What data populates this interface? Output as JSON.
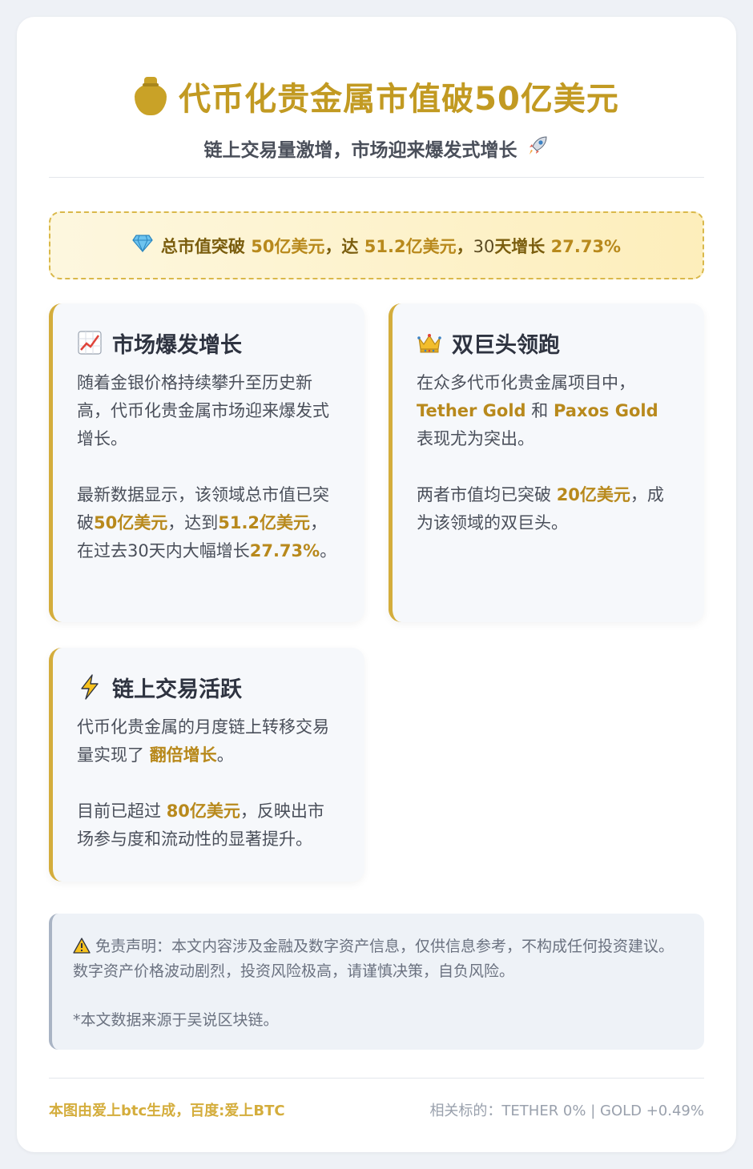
{
  "header": {
    "icon": "money-bag-icon",
    "title": "代币化贵金属市值破50亿美元",
    "subtitle": "链上交易量激增，市场迎来爆发式增长",
    "subtitle_icon": "rocket-icon"
  },
  "highlight": {
    "icon": "gem-icon",
    "p1": "总市值突破",
    "v1": "50亿美元",
    "p2": "，达",
    "v2": "51.2亿美元",
    "p3": "，",
    "p4": "30",
    "p5": "天增长",
    "v3": "27.73%"
  },
  "sections": [
    {
      "icon": "chart-increasing-icon",
      "title": "市场爆发增长",
      "para1": "随着金银价格持续攀升至历史新高，代币化贵金属市场迎来爆发式增长。",
      "para2_a": "最新数据显示，该领域总市值已突破",
      "para2_b": "50亿美元",
      "para2_c": "，达到",
      "para2_d": "51.2亿美元",
      "para2_e": "，在过去30天内大幅增长",
      "para2_f": "27.73%",
      "para2_g": "。"
    },
    {
      "icon": "crown-icon",
      "title": "双巨头领跑",
      "para1_a": "在众多代币化贵金属项目中，",
      "para1_b": "Tether Gold",
      "para1_c": "和",
      "para1_d": "Paxos Gold",
      "para1_e": "表现尤为突出。",
      "para2_a": "两者市值均已突破",
      "para2_b": "20亿美元",
      "para2_c": "，成为该领域的双巨头。"
    },
    {
      "icon": "lightning-icon",
      "title": "链上交易活跃",
      "para1_a": "代币化贵金属的月度链上转移交易量实现了",
      "para1_b": "翻倍增长",
      "para1_c": "。",
      "para2_a": "目前已超过",
      "para2_b": "80亿美元",
      "para2_c": "，反映出市场参与度和流动性的显著提升。"
    }
  ],
  "disclaimer": {
    "icon": "warning-icon",
    "text": "免责声明：本文内容涉及金融及数字资产信息，仅供信息参考，不构成任何投资建议。数字资产价格波动剧烈，投资风险极高，请谨慎决策，自负风险。",
    "source": "*本文数据来源于吴说区块链。"
  },
  "footer": {
    "left": "本图由爱上btc生成，百度:爱上BTC",
    "right": "相关标的：TETHER 0% | GOLD +0.49%"
  }
}
